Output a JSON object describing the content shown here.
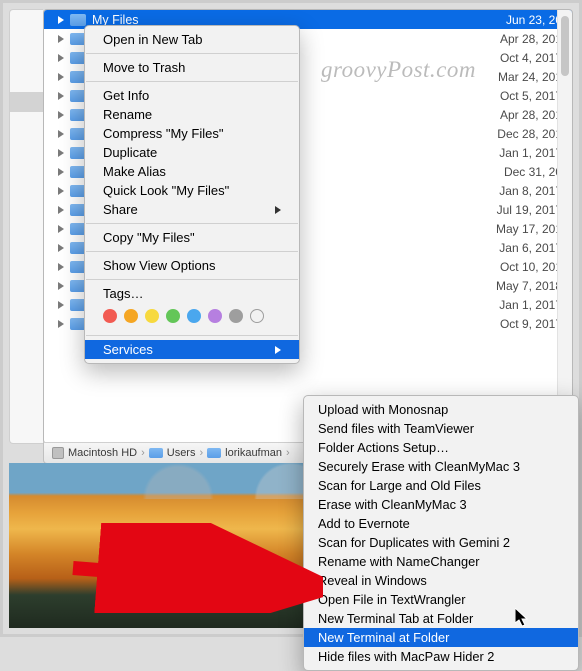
{
  "watermark": "groovyPost.com",
  "selected_file": {
    "name": "My Files",
    "date": "Jun 23, 20"
  },
  "file_dates": [
    "Apr 28, 201",
    "Oct 4, 2017",
    "Mar 24, 201",
    "Oct 5, 2017",
    "Apr 28, 201",
    "Dec 28, 201",
    "Jan 1, 2017",
    "Dec 31, 20",
    "Jan 8, 2017",
    "Jul 19, 2017",
    "May 17, 201",
    "Jan 6, 2017",
    "Oct 10, 201",
    "May 7, 2018",
    "Jan 1, 2017",
    "Oct 9, 2017"
  ],
  "path": {
    "p1": "Macintosh HD",
    "p2": "Users",
    "p3": "lorikaufman"
  },
  "context_menu": {
    "items": [
      "Open in New Tab",
      "Move to Trash",
      "Get Info",
      "Rename",
      "Compress \"My Files\"",
      "Duplicate",
      "Make Alias",
      "Quick Look \"My Files\"",
      "Share",
      "Copy \"My Files\"",
      "Show View Options",
      "Tags…",
      "Services"
    ],
    "tag_colors": [
      "#f25b52",
      "#f5a623",
      "#f7d93e",
      "#63c658",
      "#4aa7ee",
      "#b67fe0",
      "#9e9e9e"
    ]
  },
  "services_submenu": [
    "Upload with Monosnap",
    "Send files with TeamViewer",
    "Folder Actions Setup…",
    "Securely Erase with CleanMyMac 3",
    "Scan for Large and Old Files",
    "Erase with CleanMyMac 3",
    "Add to Evernote",
    "Scan for Duplicates with Gemini 2",
    "Rename with NameChanger",
    "Reveal in Windows",
    "Open File in TextWrangler",
    "New Terminal Tab at Folder",
    "New Terminal at Folder",
    "Hide files with MacPaw Hider 2"
  ],
  "highlighted_submenu_index": 12
}
